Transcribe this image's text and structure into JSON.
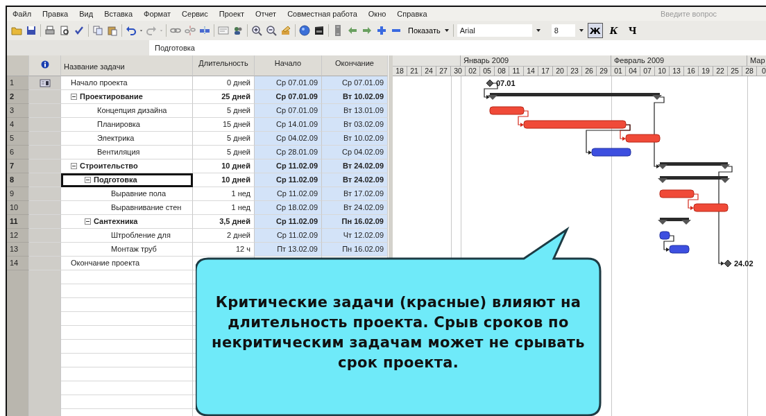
{
  "menu": [
    "Файл",
    "Правка",
    "Вид",
    "Вставка",
    "Формат",
    "Сервис",
    "Проект",
    "Отчет",
    "Совместная работа",
    "Окно",
    "Справка"
  ],
  "help_field": {
    "placeholder": "Введите вопрос"
  },
  "toolbar": {
    "show_button": "Показать",
    "font": "Arial",
    "font_size": "8",
    "bold": "Ж",
    "italic": "К",
    "underline": "Ч"
  },
  "entry_bar": {
    "value": "Подготовка"
  },
  "columns": [
    "Название задачи",
    "Длительность",
    "Начало",
    "Окончание"
  ],
  "timescale": {
    "months": [
      "Январь 2009",
      "Февраль 2009",
      "Мар"
    ],
    "days": [
      "18",
      "21",
      "24",
      "27",
      "30",
      "02",
      "05",
      "08",
      "11",
      "14",
      "17",
      "20",
      "23",
      "26",
      "29",
      "01",
      "04",
      "07",
      "10",
      "13",
      "16",
      "19",
      "22",
      "25",
      "28",
      "0"
    ]
  },
  "tasks": [
    {
      "id": "1",
      "name": "Начало проекта",
      "kind": "milestone",
      "indicator": true,
      "selected": false,
      "duration": "0 дней",
      "start": "Ср 07.01.09",
      "finish": "Ср 07.01.09",
      "gantt_label": "07.01"
    },
    {
      "id": "2",
      "name": "Проектирование",
      "kind": "summary",
      "expanded": true,
      "indicator": false,
      "selected": false,
      "duration": "25 дней",
      "start": "Ср 07.01.09",
      "finish": "Вт 10.02.09",
      "children": [
        {
          "id": "3",
          "name": "Концепция дизайна",
          "kind": "task",
          "critical": true,
          "indicator": false,
          "selected": false,
          "duration": "5 дней",
          "start": "Ср 07.01.09",
          "finish": "Вт 13.01.09"
        },
        {
          "id": "4",
          "name": "Планировка",
          "kind": "task",
          "critical": true,
          "indicator": false,
          "selected": false,
          "duration": "15 дней",
          "start": "Ср 14.01.09",
          "finish": "Вт 03.02.09"
        },
        {
          "id": "5",
          "name": "Электрика",
          "kind": "task",
          "critical": true,
          "indicator": false,
          "selected": false,
          "duration": "5 дней",
          "start": "Ср 04.02.09",
          "finish": "Вт 10.02.09"
        },
        {
          "id": "6",
          "name": "Вентиляция",
          "kind": "task",
          "critical": false,
          "indicator": false,
          "selected": false,
          "duration": "5 дней",
          "start": "Ср 28.01.09",
          "finish": "Ср 04.02.09"
        }
      ]
    },
    {
      "id": "7",
      "name": "Строительство",
      "kind": "summary",
      "expanded": true,
      "indicator": false,
      "selected": false,
      "duration": "10 дней",
      "start": "Ср 11.02.09",
      "finish": "Вт 24.02.09",
      "children": [
        {
          "id": "8",
          "name": "Подготовка",
          "kind": "summary",
          "expanded": true,
          "indicator": false,
          "selected": true,
          "duration": "10 дней",
          "start": "Ср 11.02.09",
          "finish": "Вт 24.02.09",
          "children": [
            {
              "id": "9",
              "name": "Выравние пола",
              "kind": "task",
              "critical": true,
              "indicator": false,
              "selected": false,
              "duration": "1 нед",
              "start": "Ср 11.02.09",
              "finish": "Вт 17.02.09"
            },
            {
              "id": "10",
              "name": "Выравнивание стен",
              "kind": "task",
              "critical": true,
              "indicator": false,
              "selected": false,
              "duration": "1 нед",
              "start": "Ср 18.02.09",
              "finish": "Вт 24.02.09"
            }
          ]
        },
        {
          "id": "11",
          "name": "Сантехника",
          "kind": "summary",
          "expanded": true,
          "indicator": false,
          "selected": false,
          "duration": "3,5 дней",
          "start": "Ср 11.02.09",
          "finish": "Пн 16.02.09",
          "children": [
            {
              "id": "12",
              "name": "Штробление для",
              "kind": "task",
              "critical": false,
              "indicator": false,
              "selected": false,
              "duration": "2 дней",
              "start": "Ср 11.02.09",
              "finish": "Чт 12.02.09"
            },
            {
              "id": "13",
              "name": "Монтаж труб",
              "kind": "task",
              "critical": false,
              "indicator": false,
              "selected": false,
              "duration": "12 ч",
              "start": "Пт 13.02.09",
              "finish": "Пн 16.02.09"
            }
          ]
        }
      ]
    },
    {
      "id": "14",
      "name": "Окончание проекта",
      "kind": "milestone",
      "indicator": false,
      "selected": false,
      "gantt_label": "24.02"
    }
  ],
  "callout": {
    "text": "Критические задачи (красные) влияют на длительность проекта. Срыв сроков по некритическим задачам может не срывать срок проекта."
  }
}
